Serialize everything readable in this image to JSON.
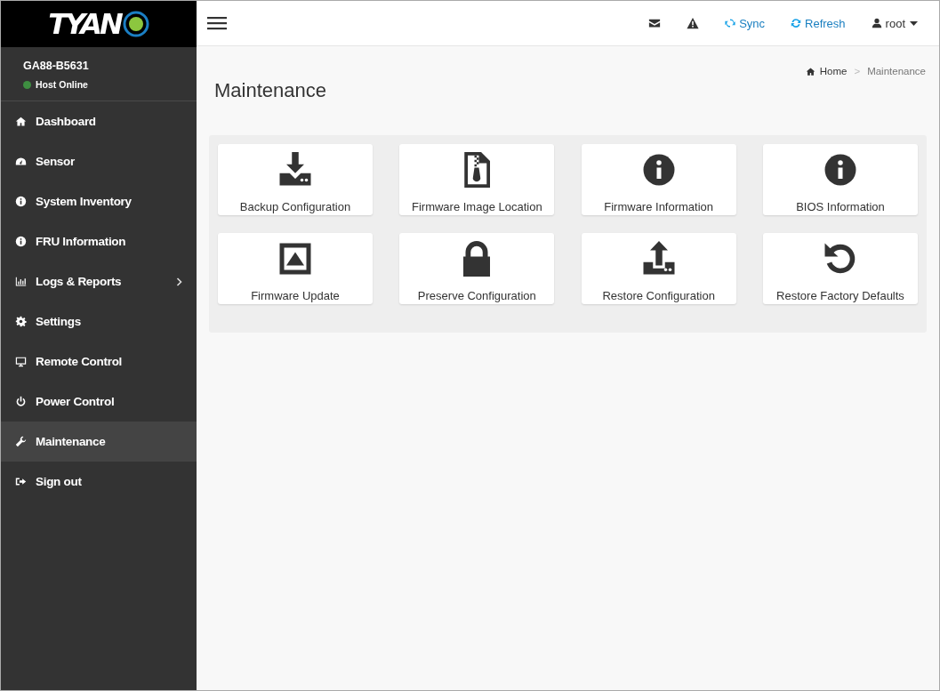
{
  "logo": {
    "text": "TYAN"
  },
  "host": {
    "name": "GA88-B5631",
    "status": "Host Online",
    "color": "#3e8e41"
  },
  "sidebar": {
    "items": [
      {
        "label": "Dashboard",
        "kind": "home",
        "selected": false,
        "expandable": false
      },
      {
        "label": "Sensor",
        "kind": "gauge",
        "selected": false,
        "expandable": false
      },
      {
        "label": "System Inventory",
        "kind": "info",
        "selected": false,
        "expandable": false
      },
      {
        "label": "FRU Information",
        "kind": "info",
        "selected": false,
        "expandable": false
      },
      {
        "label": "Logs & Reports",
        "kind": "chart",
        "selected": false,
        "expandable": true
      },
      {
        "label": "Settings",
        "kind": "gear",
        "selected": false,
        "expandable": false
      },
      {
        "label": "Remote Control",
        "kind": "monitor",
        "selected": false,
        "expandable": false
      },
      {
        "label": "Power Control",
        "kind": "power",
        "selected": false,
        "expandable": false
      },
      {
        "label": "Maintenance",
        "kind": "wrench",
        "selected": true,
        "expandable": false
      },
      {
        "label": "Sign out",
        "kind": "signout",
        "selected": false,
        "expandable": false
      }
    ]
  },
  "topbar": {
    "actions": [
      {
        "kind": "mail"
      },
      {
        "kind": "warning"
      },
      {
        "kind": "sync",
        "label": "Sync"
      },
      {
        "kind": "refresh",
        "label": "Refresh"
      },
      {
        "kind": "user",
        "label": "root"
      }
    ]
  },
  "page": {
    "title": "Maintenance",
    "breadcrumb": [
      "Home",
      "Maintenance"
    ],
    "breadcrumb_separator": ">"
  },
  "tiles": [
    {
      "label": "Backup Configuration",
      "kind": "download"
    },
    {
      "label": "Firmware Image Location",
      "kind": "zipfile"
    },
    {
      "label": "Firmware Information",
      "kind": "info"
    },
    {
      "label": "BIOS Information",
      "kind": "info"
    },
    {
      "label": "Firmware Update",
      "kind": "upbox"
    },
    {
      "label": "Preserve Configuration",
      "kind": "lock"
    },
    {
      "label": "Restore Configuration",
      "kind": "upload"
    },
    {
      "label": "Restore Factory Defaults",
      "kind": "undo"
    }
  ]
}
